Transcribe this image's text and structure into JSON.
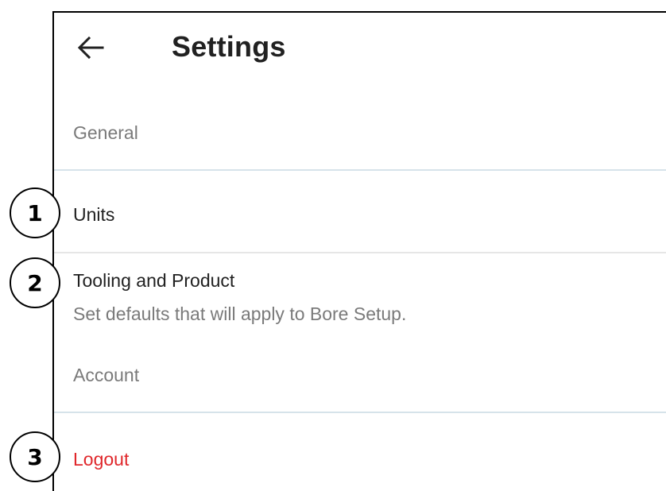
{
  "app_bar": {
    "back_icon": "arrow-left-icon",
    "title": "Settings"
  },
  "sections": {
    "general": {
      "header": "General",
      "items": {
        "units": {
          "title": "Units"
        },
        "tooling": {
          "title": "Tooling and Product",
          "subtitle": "Set defaults that will apply to Bore Setup."
        }
      }
    },
    "account": {
      "header": "Account",
      "items": {
        "logout": {
          "title": "Logout"
        }
      }
    }
  },
  "callouts": [
    "1",
    "2",
    "3"
  ],
  "colors": {
    "title_text": "#212121",
    "secondary_text": "#7a7a7a",
    "divider": "#d6e3ea",
    "logout": "#e0272b"
  }
}
